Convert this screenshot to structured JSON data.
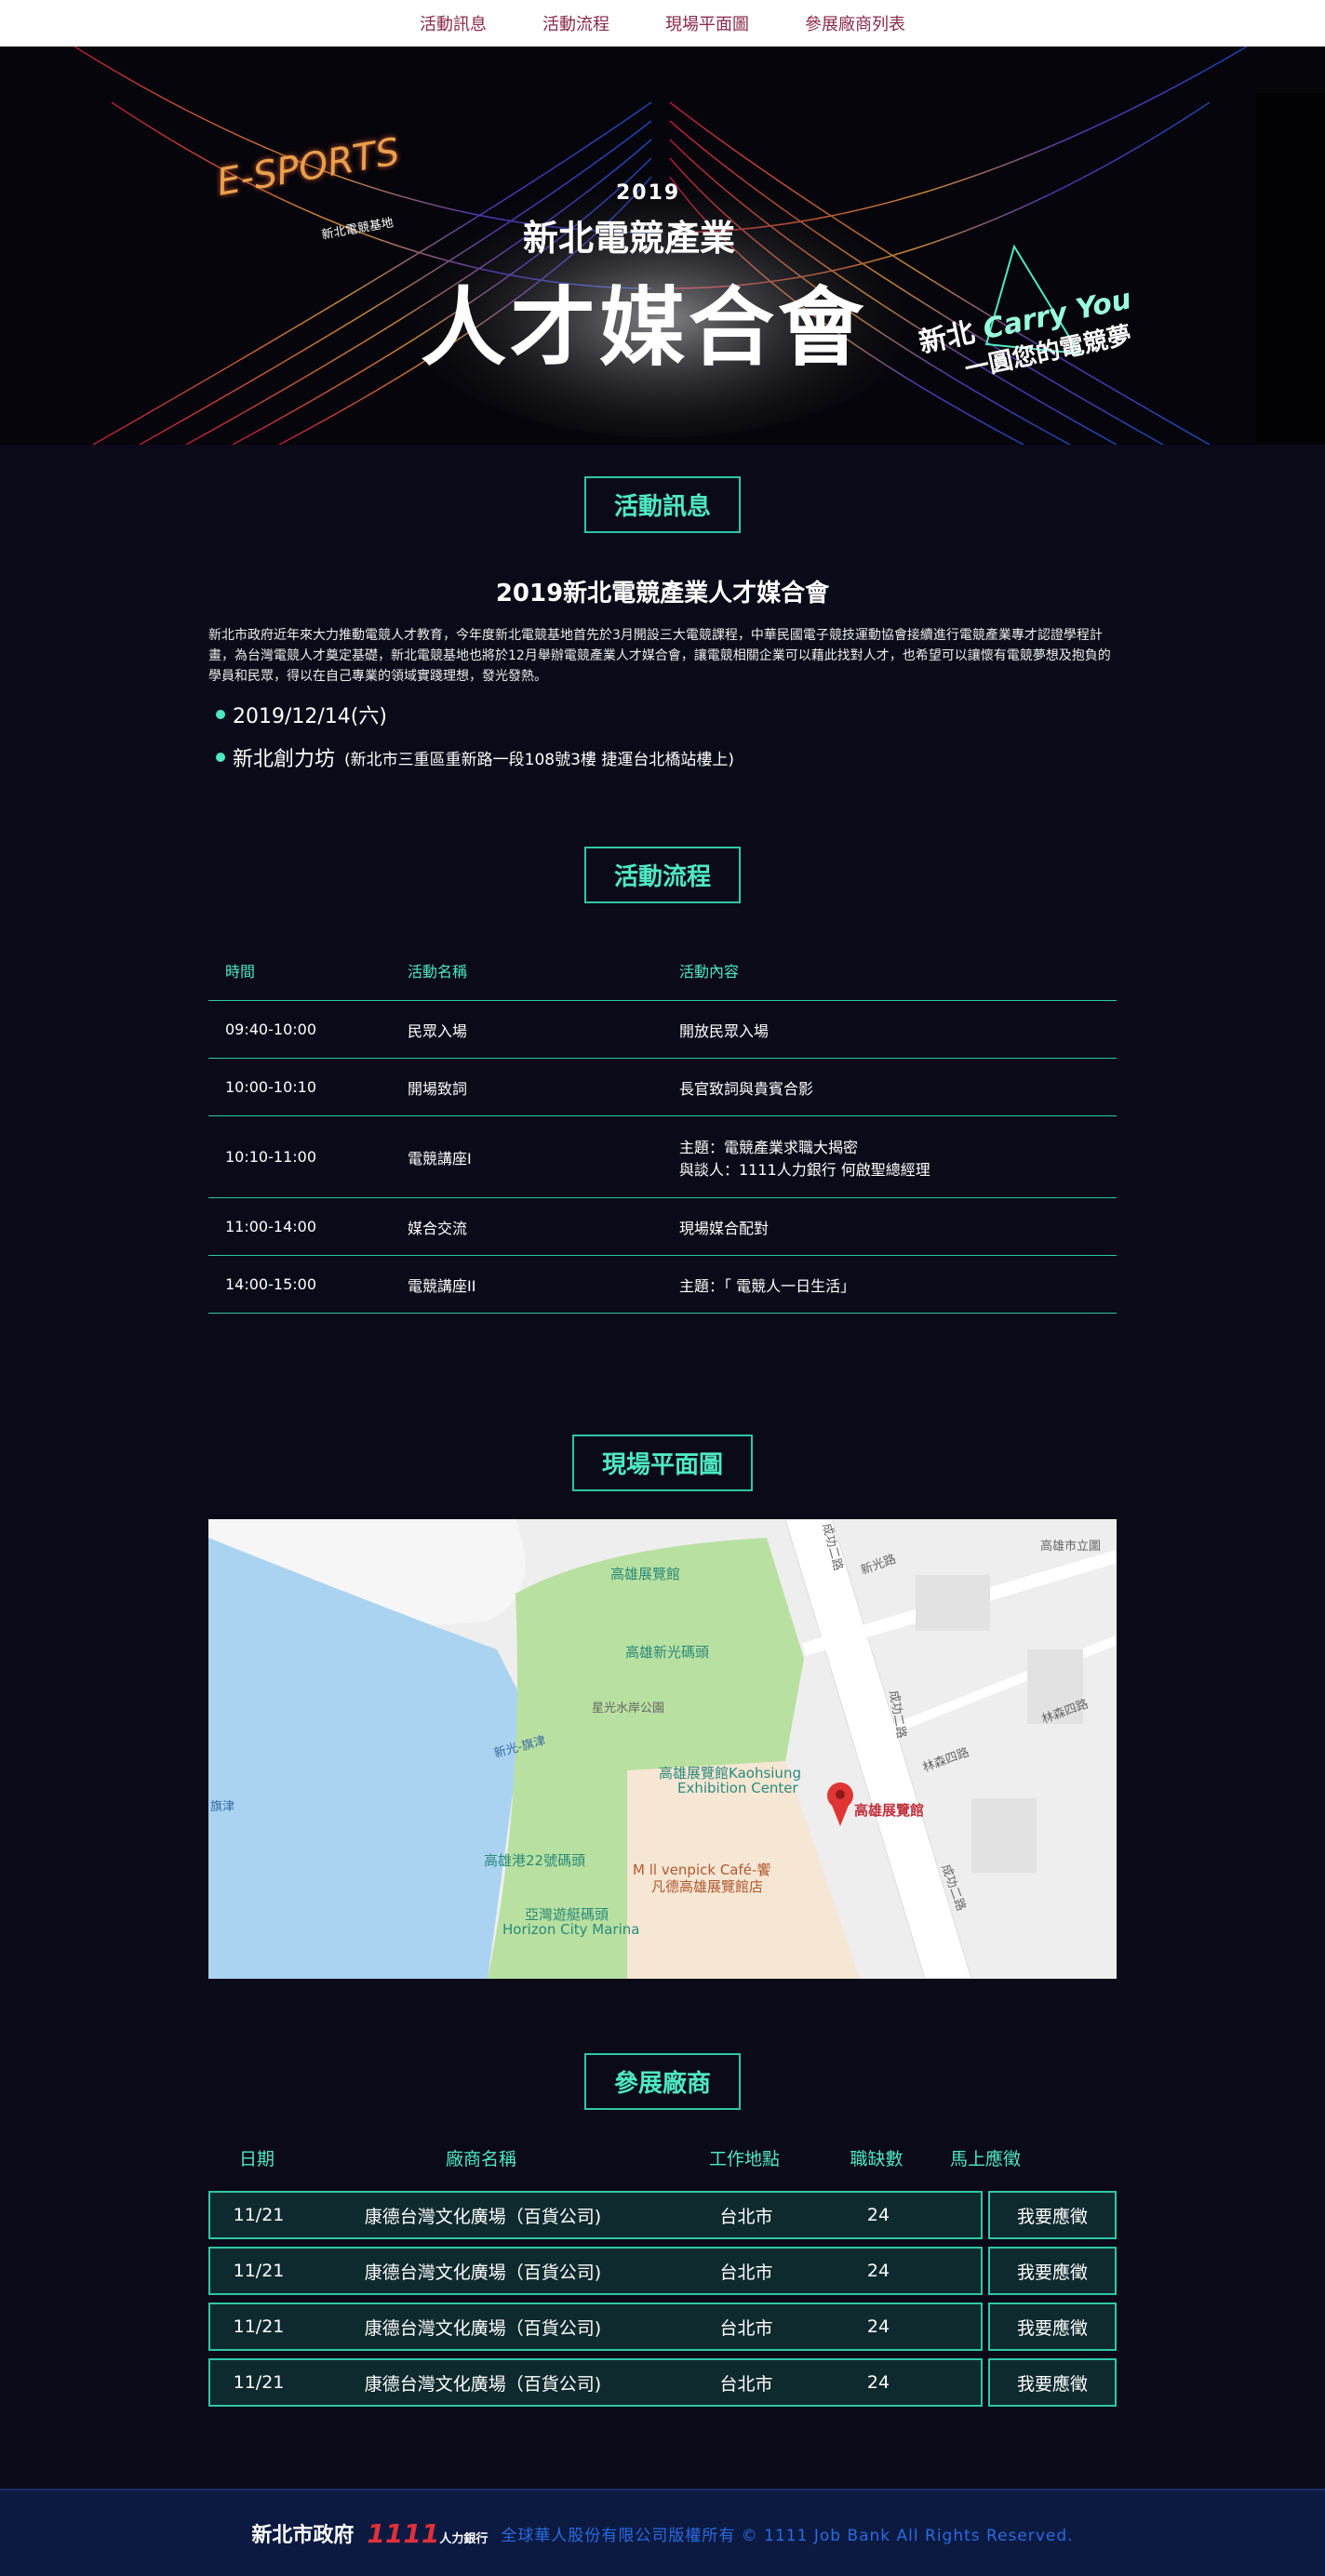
{
  "nav": [
    "活動訊息",
    "活動流程",
    "現場平面圖",
    "參展廠商列表"
  ],
  "banner": {
    "logo_text": "E-SPORTS",
    "logo_tag": "新北電競基地",
    "year": "2019",
    "subtitle": "新北電競產業",
    "title": "人才媒合會",
    "slogan_a": "新北",
    "slogan_b": "Carry You",
    "slogan_c": "一圓您的電競夢"
  },
  "info": {
    "section_title": "活動訊息",
    "heading": "2019新北電競產業人才媒合會",
    "paragraph": "新北市政府近年來大力推動電競人才教育，今年度新北電競基地首先於3月開設三大電競課程，中華民國電子競技運動協會接續進行電競產業專才認證學程計畫，為台灣電競人才奠定基礎，新北電競基地也將於12月舉辦電競產業人才媒合會，讓電競相關企業可以藉此找對人才，也希望可以讓懷有電競夢想及抱負的學員和民眾，得以在自己專業的領域實踐理想，發光發熱。",
    "date": "2019/12/14(六)",
    "venue": "新北創力坊",
    "address": "(新北市三重區重新路一段108號3樓 捷運台北橋站樓上)"
  },
  "flow": {
    "section_title": "活動流程",
    "headers": [
      "時間",
      "活動名稱",
      "活動內容"
    ],
    "rows": [
      {
        "time": "09:40-10:00",
        "name": "民眾入場",
        "content": "開放民眾入場",
        "content2": ""
      },
      {
        "time": "10:00-10:10",
        "name": "開場致詞",
        "content": "長官致詞與貴賓合影",
        "content2": ""
      },
      {
        "time": "10:10-11:00",
        "name": "電競講座I",
        "content": "主題：電競產業求職大揭密",
        "content2": "與談人：1111人力銀行 何啟聖總經理"
      },
      {
        "time": "11:00-14:00",
        "name": "媒合交流",
        "content": "現場媒合配對",
        "content2": ""
      },
      {
        "time": "14:00-15:00",
        "name": "電競講座II",
        "content": "主題：「 電競人一日生活」",
        "content2": ""
      }
    ]
  },
  "map": {
    "section_title": "現場平面圖",
    "labels": {
      "hall_top": "高雄展覽館",
      "pier": "高雄新光碼頭",
      "park": "星光水岸公園",
      "center1": "高雄展覽館Kaohsiung",
      "center2": "Exhibition Center",
      "pin": "高雄展覽館",
      "cafe1": "M ll venpick Café-饗",
      "cafe2": "凡德高雄展覽館店",
      "pier22": "高雄港22號碼頭",
      "marina1": "亞灣遊艇碼頭",
      "marina2": "Horizon City Marina",
      "road1": "成功二路",
      "road2": "新光路",
      "road3": "成功二路",
      "road4": "林森四路",
      "road5": "林森四路",
      "road6": "新光-旗津",
      "road7": "旗津",
      "road8": "成功二路",
      "corner": "高雄市立圖"
    }
  },
  "vendors": {
    "section_title": "參展廠商",
    "headers": [
      "日期",
      "廠商名稱",
      "工作地點",
      "職缺數",
      "馬上應徵"
    ],
    "apply_label": "我要應徵",
    "rows": [
      {
        "date": "11/21",
        "name": "康德台灣文化廣場（百貨公司)",
        "location": "台北市",
        "count": "24"
      },
      {
        "date": "11/21",
        "name": "康德台灣文化廣場（百貨公司)",
        "location": "台北市",
        "count": "24"
      },
      {
        "date": "11/21",
        "name": "康德台灣文化廣場（百貨公司)",
        "location": "台北市",
        "count": "24"
      },
      {
        "date": "11/21",
        "name": "康德台灣文化廣場（百貨公司)",
        "location": "台北市",
        "count": "24"
      }
    ]
  },
  "footer": {
    "logo_gov": "新北市政府",
    "logo_bank": "1111",
    "logo_bank_sub": "人力銀行",
    "copyright": "全球華人股份有限公司版權所有 © 1111 Job Bank All Rights Reserved."
  },
  "colors": {
    "accent": "#4ee8c3",
    "border": "#2ec7a6",
    "background": "#0b0a18",
    "nav_text": "#8a2a4a"
  }
}
